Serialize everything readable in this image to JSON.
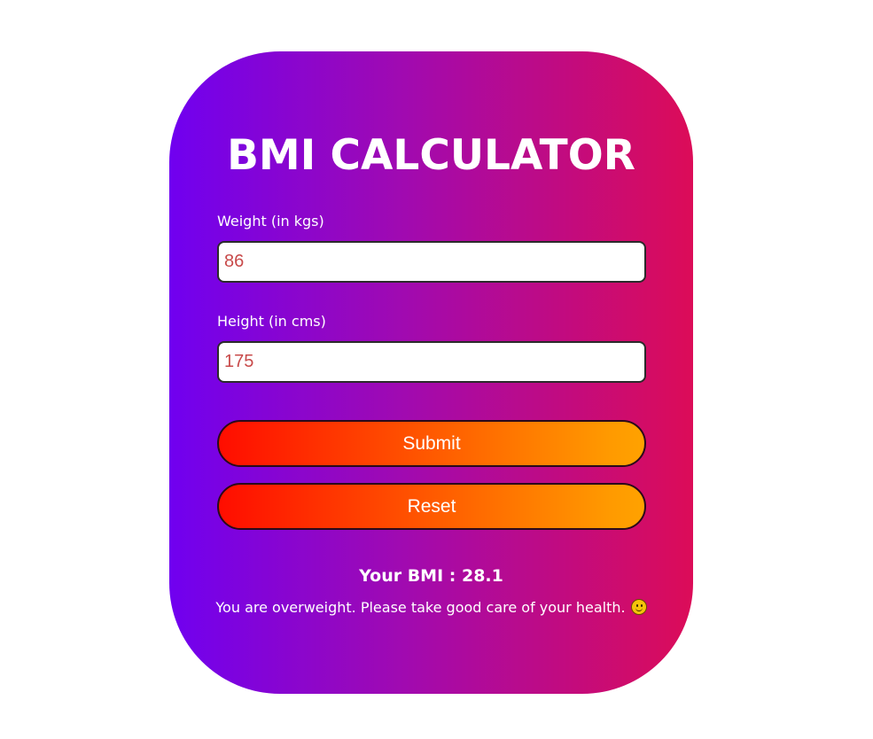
{
  "card": {
    "title": "BMI CALCULATOR",
    "weight": {
      "label": "Weight (in kgs)",
      "value": "86"
    },
    "height": {
      "label": "Height (in cms)",
      "value": "175"
    },
    "submit_label": "Submit",
    "reset_label": "Reset",
    "result": "Your BMI : 28.1",
    "message": "You are overweight. Please take good care of your health.",
    "message_icon": "smiley-face-icon"
  },
  "colors": {
    "card_gradient_start": "#7000f0",
    "card_gradient_end": "#dc0c58",
    "button_gradient_start": "#ff0d00",
    "button_gradient_end": "#ffa200",
    "input_text": "#c84a4a"
  }
}
